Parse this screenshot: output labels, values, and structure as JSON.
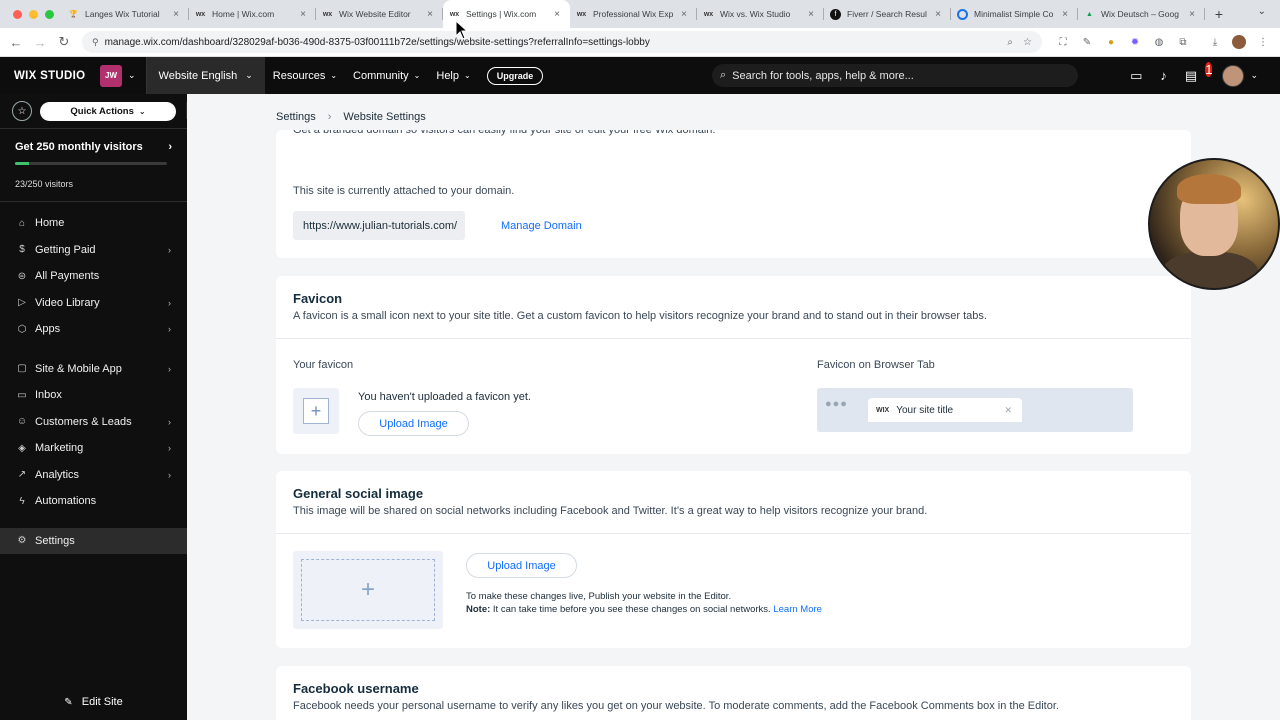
{
  "browser": {
    "tabs": [
      {
        "title": "Langes Wix Tutorial",
        "favicon": "trophy-icon",
        "active": false
      },
      {
        "title": "Home | Wix.com",
        "favicon": "wix-icon",
        "active": false
      },
      {
        "title": "Wix Website Editor",
        "favicon": "wix-icon",
        "active": false
      },
      {
        "title": "Settings | Wix.com",
        "favicon": "wix-icon",
        "active": true
      },
      {
        "title": "Professional Wix Exp",
        "favicon": "wix-icon",
        "active": false
      },
      {
        "title": "Wix vs. Wix Studio",
        "favicon": "wix-icon",
        "active": false
      },
      {
        "title": "Fiverr / Search Resul",
        "favicon": "fiverr-icon",
        "active": false
      },
      {
        "title": "Minimalist Simple Co",
        "favicon": "circle-icon",
        "active": false
      },
      {
        "title": "Wix Deutsch – Goog",
        "favicon": "drive-icon",
        "active": false
      }
    ],
    "new_tab": "+",
    "url": "manage.wix.com/dashboard/328029af-b036-490d-8375-03f00111b72e/settings/website-settings?referralInfo=settings-lobby"
  },
  "topnav": {
    "logo": "WIX STUDIO",
    "site_initials": "JW",
    "site_name": "Website English",
    "items": [
      {
        "label": "Resources"
      },
      {
        "label": "Community"
      },
      {
        "label": "Help"
      }
    ],
    "upgrade": "Upgrade",
    "search_placeholder": "Search for tools, apps, help & more...",
    "notification_count": "1"
  },
  "sidebar": {
    "quick_actions": "Quick Actions",
    "visitors_title": "Get 250 monthly visitors",
    "visitors_count": "23/250 visitors",
    "visitors_fraction": 0.092,
    "items": [
      {
        "label": "Home",
        "icon": "home-icon",
        "arrow": false
      },
      {
        "label": "Getting Paid",
        "icon": "dollar-icon",
        "arrow": true
      },
      {
        "label": "All Payments",
        "icon": "payments-icon",
        "arrow": false
      },
      {
        "label": "Video Library",
        "icon": "video-icon",
        "arrow": true
      },
      {
        "label": "Apps",
        "icon": "apps-icon",
        "arrow": true
      },
      {
        "label": "Site & Mobile App",
        "icon": "site-icon",
        "arrow": true
      },
      {
        "label": "Inbox",
        "icon": "inbox-icon",
        "arrow": false
      },
      {
        "label": "Customers & Leads",
        "icon": "customers-icon",
        "arrow": true
      },
      {
        "label": "Marketing",
        "icon": "marketing-icon",
        "arrow": true
      },
      {
        "label": "Analytics",
        "icon": "analytics-icon",
        "arrow": true
      },
      {
        "label": "Automations",
        "icon": "automations-icon",
        "arrow": false
      },
      {
        "label": "Settings",
        "icon": "gear-icon",
        "arrow": false
      }
    ],
    "edit_site": "Edit Site"
  },
  "main": {
    "breadcrumb": {
      "root": "Settings",
      "current": "Website Settings"
    },
    "domain": {
      "subtitle_partial": "Get a branded domain so visitors can easily find your site or edit your free Wix domain.",
      "attached_text": "This site is currently attached to your domain.",
      "domain_url": "https://www.julian-tutorials.com/",
      "manage_link": "Manage Domain"
    },
    "favicon": {
      "title": "Favicon",
      "subtitle": "A favicon is a small icon next to your site title. Get a custom favicon to help visitors recognize your brand and to stand out in their browser tabs.",
      "your_favicon_label": "Your favicon",
      "empty_text": "You haven't uploaded a favicon yet.",
      "upload_button": "Upload Image",
      "preview_label": "Favicon on Browser Tab",
      "preview_tab_title": "Your site title",
      "preview_logo": "WIX"
    },
    "social": {
      "title": "General social image",
      "subtitle": "This image will be shared on social networks including Facebook and Twitter. It’s a great way to help visitors recognize your brand.",
      "upload_button": "Upload Image",
      "publish_note": "To make these changes live, Publish your website in the Editor.",
      "note_label": "Note:",
      "note_text": " It can take time before you see these changes on social networks. ",
      "learn_more": "Learn More"
    },
    "facebook": {
      "title": "Facebook username",
      "subtitle": "Facebook needs your personal username to verify any likes you get on your website. To moderate comments, add the Facebook Comments box in the Editor."
    }
  },
  "colors": {
    "accent": "#116dff",
    "sidebar_bg": "#0f0f0f",
    "site_badge": "#b2306d",
    "progress": "#3fc26b"
  }
}
